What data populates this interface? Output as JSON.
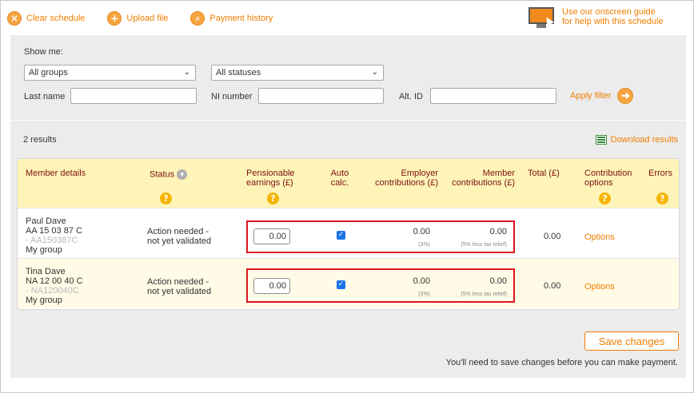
{
  "toolbar": {
    "clear_schedule": "Clear schedule",
    "upload_file": "Upload file",
    "payment_history": "Payment history"
  },
  "guide": {
    "line1": "Use our onscreen guide",
    "line2": "for help with this schedule"
  },
  "filter": {
    "show_me": "Show me:",
    "groups_selected": "All groups",
    "statuses_selected": "All statuses",
    "last_name_label": "Last name",
    "ni_number_label": "NI number",
    "alt_id_label": "Alt. ID",
    "last_name_value": "",
    "ni_number_value": "",
    "alt_id_value": "",
    "apply_label": "Apply filter"
  },
  "results": {
    "count": "2 results",
    "download": "Download results"
  },
  "table": {
    "headers": {
      "member": "Member details",
      "status": "Status",
      "pensionable_1": "Pensionable",
      "pensionable_2": "earnings (£)",
      "auto_1": "Auto",
      "auto_2": "calc.",
      "employer_1": "Employer",
      "employer_2": "contributions (£)",
      "member_1": "Member",
      "member_2": "contributions (£)",
      "total": "Total (£)",
      "options_1": "Contribution",
      "options_2": "options",
      "errors": "Errors"
    },
    "rows": [
      {
        "name": "Paul Dave",
        "ni": "AA 15 03 87 C",
        "alt_id": "- AA150387C",
        "group": "My group",
        "status_1": "Action needed -",
        "status_2": "not yet validated",
        "earnings": "0.00",
        "auto_calc": true,
        "employer": "0.00",
        "employer_note": "(3%)",
        "member": "0.00",
        "member_note": "(5% less tax relief)",
        "total": "0.00",
        "options": "Options"
      },
      {
        "name": "Tina Dave",
        "ni": "NA 12 00 40 C",
        "alt_id": "- NA120040C",
        "group": "My group",
        "status_1": "Action needed -",
        "status_2": "not yet validated",
        "earnings": "0.00",
        "auto_calc": true,
        "employer": "0.00",
        "employer_note": "(3%)",
        "member": "0.00",
        "member_note": "(5% less tax relief)",
        "total": "0.00",
        "options": "Options"
      }
    ]
  },
  "footer": {
    "save": "Save changes",
    "note": "You'll need to save changes before you can make payment."
  },
  "colors": {
    "accent": "#f07d00",
    "header_bg": "#fff4b8",
    "header_text": "#7a1010",
    "highlight_box": "#e0141e"
  }
}
